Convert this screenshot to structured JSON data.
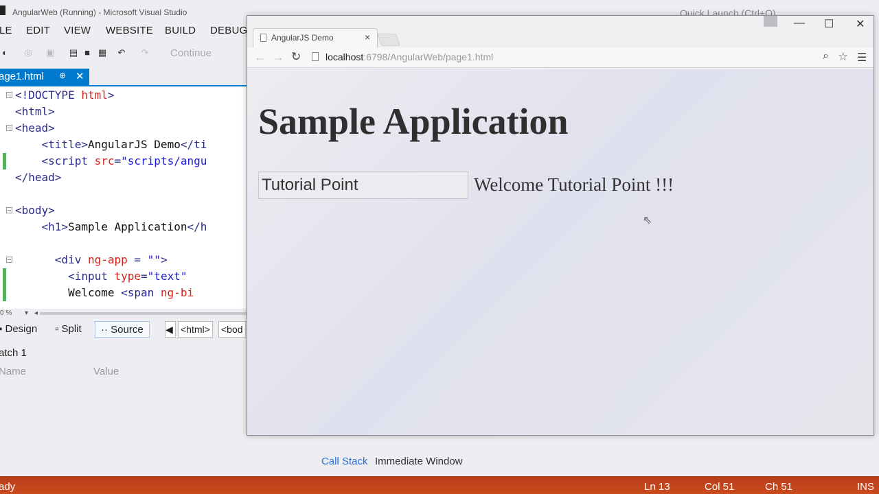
{
  "vs": {
    "title": "AngularWeb (Running) - Microsoft Visual Studio",
    "quick_launch": "Quick Launch (Ctrl+Q)",
    "menu": [
      "LE",
      "EDIT",
      "VIEW",
      "WEBSITE",
      "BUILD",
      "DEBUG"
    ],
    "toolbar": {
      "continue_label": "Continue"
    },
    "tab": {
      "filename": "age1.html",
      "pin": "⊕",
      "close": "✕"
    },
    "code": [
      {
        "parts": [
          [
            "t",
            "<!DOCTYPE "
          ],
          [
            "a",
            "html"
          ],
          [
            "t",
            ">"
          ]
        ]
      },
      {
        "parts": [
          [
            "t",
            "<html>"
          ]
        ]
      },
      {
        "parts": [
          [
            "t",
            "<head>"
          ]
        ]
      },
      {
        "parts": [
          [
            "t",
            "    <title>"
          ],
          [
            "x",
            "AngularJS Demo"
          ],
          [
            "t",
            "</ti"
          ]
        ]
      },
      {
        "parts": [
          [
            "t",
            "    <script "
          ],
          [
            "a",
            "src"
          ],
          [
            "t",
            "="
          ],
          [
            "v",
            "\"scripts/angu"
          ]
        ]
      },
      {
        "parts": [
          [
            "t",
            "</head>"
          ]
        ]
      },
      {
        "parts": []
      },
      {
        "parts": [
          [
            "t",
            "<body>"
          ]
        ]
      },
      {
        "parts": [
          [
            "t",
            "    <h1>"
          ],
          [
            "x",
            "Sample Application"
          ],
          [
            "t",
            "</h"
          ]
        ]
      },
      {
        "parts": []
      },
      {
        "parts": [
          [
            "t",
            "      <div "
          ],
          [
            "a",
            "ng-app"
          ],
          [
            "t",
            " = "
          ],
          [
            "v",
            "\"\""
          ],
          [
            "t",
            ">"
          ]
        ]
      },
      {
        "parts": [
          [
            "t",
            "        <input "
          ],
          [
            "a",
            "type"
          ],
          [
            "t",
            "="
          ],
          [
            "v",
            "\"text\""
          ],
          [
            "t",
            " "
          ]
        ]
      },
      {
        "parts": [
          [
            "x",
            "        Welcome "
          ],
          [
            "t",
            "<span "
          ],
          [
            "a",
            "ng-bi"
          ]
        ]
      }
    ],
    "zoom": "0 %",
    "view_tabs": {
      "design": "Design",
      "split": "Split",
      "source": "Source"
    },
    "breadcrumbs": [
      "<html>",
      "<bod"
    ],
    "watch": {
      "title": "atch 1",
      "col_name": "Name",
      "col_value": "Value"
    },
    "bottom_tabs": {
      "call_stack": "Call Stack",
      "immediate": "Immediate Window"
    },
    "status": {
      "ready": "ady",
      "ln": "Ln 13",
      "col": "Col 51",
      "ch": "Ch 51",
      "ins": "INS"
    }
  },
  "browser": {
    "tab_title": "AngularJS Demo",
    "tab_close": "×",
    "url_host": "localhost",
    "url_rest": ":6798/AngularWeb/page1.html",
    "page": {
      "heading": "Sample Application",
      "input_value": "Tutorial Point",
      "welcome_text": "Welcome Tutorial Point !!!"
    }
  },
  "colors": {
    "accent": "#007acc",
    "status_bar": "#c94a1c"
  }
}
